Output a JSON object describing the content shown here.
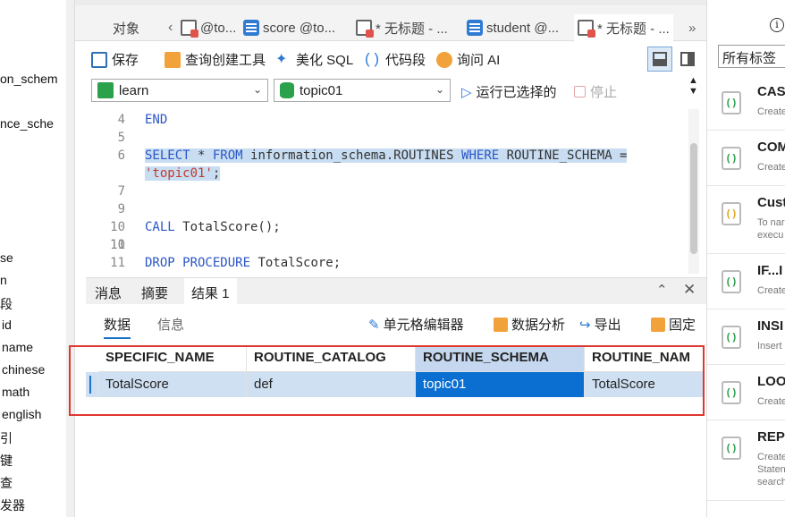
{
  "left_tree": [
    "on_schem",
    "nce_sche",
    "se",
    "n",
    "段",
    "id",
    "name",
    "chinese",
    "math",
    "english",
    "引",
    "键",
    "查",
    "发器"
  ],
  "tabs": [
    {
      "label": "对象"
    },
    {
      "label": "@to..."
    },
    {
      "label": "score @to..."
    },
    {
      "label": "* 无标题 - ..."
    },
    {
      "label": "student @..."
    },
    {
      "label": "* 无标题 - ..."
    }
  ],
  "toolbar": {
    "save": "保存",
    "query_builder": "查询创建工具",
    "beautify": "美化 SQL",
    "snippet": "代码段",
    "ask_ai": "询问 AI"
  },
  "selects": {
    "connection": "learn",
    "database": "topic01",
    "run_selected": "运行已选择的",
    "stop": "停止"
  },
  "editor": {
    "lines": [
      {
        "n": "4",
        "code": "END"
      },
      {
        "n": "5",
        "code": ""
      },
      {
        "n": "6",
        "code": "SELECT * FROM information_schema.ROUTINES WHERE ROUTINE_SCHEMA ="
      },
      {
        "n": "",
        "code": "'topic01';"
      },
      {
        "n": "7",
        "code": ""
      },
      {
        "n": "9",
        "code": "CALL TotalScore();"
      },
      {
        "n": "10",
        "code": ""
      },
      {
        "n": "11",
        "code": "DROP PROCEDURE TotalScore;"
      }
    ]
  },
  "result_tabs": {
    "messages": "消息",
    "summary": "摘要",
    "result1": "结果 1"
  },
  "subtabs": {
    "data": "数据",
    "info": "信息"
  },
  "result_tools": {
    "cell_editor": "单元格编辑器",
    "analysis": "数据分析",
    "export": "导出",
    "pin": "固定"
  },
  "grid": {
    "columns": [
      "SPECIFIC_NAME",
      "ROUTINE_CATALOG",
      "ROUTINE_SCHEMA",
      "ROUTINE_NAM"
    ],
    "rows": [
      [
        "TotalScore",
        "def",
        "topic01",
        "TotalScore"
      ]
    ]
  },
  "right_panel": {
    "info_icon": "i",
    "tag_filter": "所有标签",
    "snippets": [
      {
        "title": "CAS",
        "sub": "Create"
      },
      {
        "title": "COM",
        "sub": "Create"
      },
      {
        "title": "Cust",
        "sub": "To nar\nexecu"
      },
      {
        "title": "IF...I",
        "sub": "Create"
      },
      {
        "title": "INSI",
        "sub": "Insert"
      },
      {
        "title": "LOO",
        "sub": "Create"
      },
      {
        "title": "REPI",
        "sub": "Create\nStaten\nsearch"
      }
    ]
  }
}
